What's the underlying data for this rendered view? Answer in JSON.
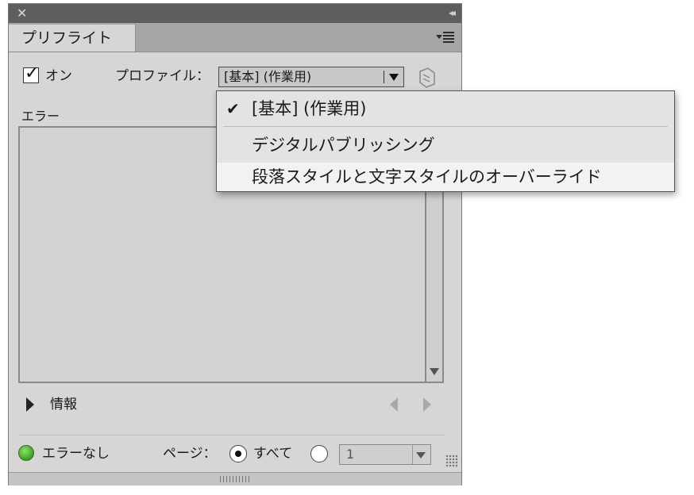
{
  "panel": {
    "close_glyph": "✕",
    "collapse_glyph": "◂◂",
    "tab_title": "プリフライト"
  },
  "controls": {
    "on_label": "オン",
    "on_checked": true,
    "profile_label": "プロファイル：",
    "profile_value": "[基本] (作業用)"
  },
  "errors": {
    "label": "エラー"
  },
  "info": {
    "label": "情報"
  },
  "footer": {
    "status_text": "エラーなし",
    "status_color": "#4caf2a",
    "page_label": "ページ：",
    "radio_all_label": "すべて",
    "radio_all_selected": true,
    "page_range_value": "1"
  },
  "dropdown": {
    "items": [
      {
        "label": "[基本] (作業用)",
        "checked": true
      },
      {
        "label": "デジタルパブリッシング",
        "checked": false
      },
      {
        "label": "段落スタイルと文字スタイルのオーバーライド",
        "checked": false
      }
    ]
  }
}
